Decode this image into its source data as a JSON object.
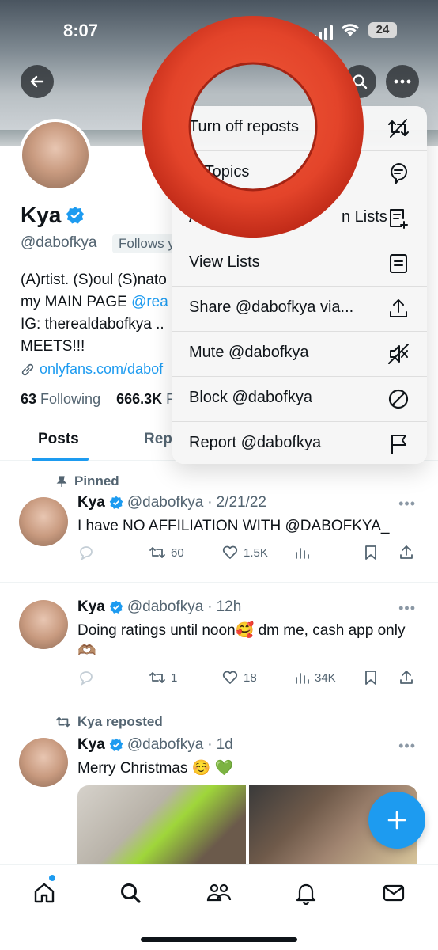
{
  "status_bar": {
    "time": "8:07",
    "battery": "24"
  },
  "profile": {
    "name": "Kya",
    "handle": "@dabofkya",
    "follows_badge": "Follows y",
    "bio_line1": "(A)rtist. (S)oul (S)nato",
    "bio_line2_prefix": "my MAIN PAGE ",
    "bio_line2_link": "@rea",
    "bio_line3": "IG: therealdabofkya ..",
    "bio_line4": "MEETS!!!",
    "url": "onlyfans.com/dabof",
    "following_count": "63",
    "following_label": "Following",
    "followers_count": "666.3K",
    "followers_label": "F"
  },
  "tabs": [
    "Posts",
    "Rep"
  ],
  "menu": {
    "items": [
      {
        "label": "Turn off reposts",
        "icon": "repost-off-icon"
      },
      {
        "label": "View Topics",
        "visible": "w Topics",
        "icon": "topics-icon"
      },
      {
        "label": "A",
        "label_end": "n Lists",
        "icon": "add-to-list-icon"
      },
      {
        "label": "View Lists",
        "icon": "lists-icon"
      },
      {
        "label": "Share @dabofkya via...",
        "icon": "share-icon"
      },
      {
        "label": "Mute @dabofkya",
        "icon": "mute-icon"
      },
      {
        "label": "Block @dabofkya",
        "icon": "block-icon"
      },
      {
        "label": "Report @dabofkya",
        "icon": "flag-icon"
      }
    ]
  },
  "tweets": [
    {
      "context": "Pinned",
      "name": "Kya",
      "handle": "@dabofkya",
      "time": "2/21/22",
      "text": "I have NO AFFILIATION WITH @DABOFKYA_",
      "reposts": "60",
      "likes": "1.5K",
      "views": ""
    },
    {
      "name": "Kya",
      "handle": "@dabofkya",
      "time": "12h",
      "text": "Doing ratings until noon🥰 dm me, cash app only🫶🏽",
      "reposts": "1",
      "likes": "18",
      "views": "34K"
    },
    {
      "context": "Kya reposted",
      "name": "Kya",
      "handle": "@dabofkya",
      "time": "1d",
      "text": "Merry Christmas ☺️ 💚"
    }
  ],
  "colors": {
    "accent": "#1d9bf0",
    "ring": "#e6472c"
  }
}
